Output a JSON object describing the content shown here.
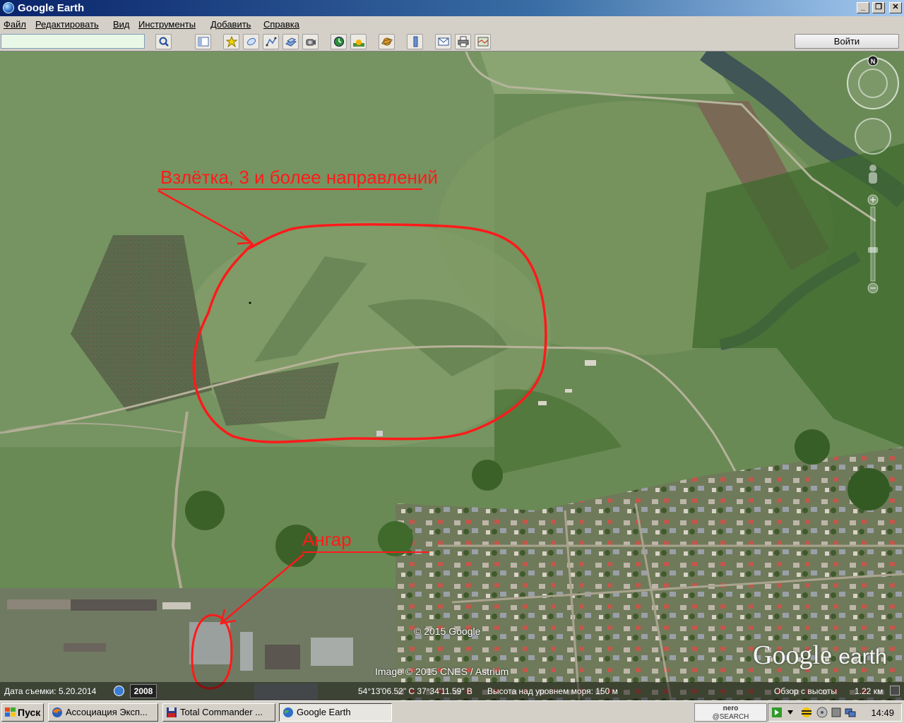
{
  "window": {
    "title": "Google Earth"
  },
  "menu": [
    "Файл",
    "Редактировать",
    "Вид",
    "Инструменты",
    "Добавить",
    "Справка"
  ],
  "toolbar": {
    "search_value": "",
    "signin_label": "Войти"
  },
  "annotations": {
    "runway_label": "Взлётка, 3 и более направлений",
    "hangar_label": "Ангар"
  },
  "map": {
    "copyright_top": "© 2015 Google",
    "copyright_image": "Image © 2015 CNES / Astrium",
    "logo_text": "Google",
    "logo_suffix": "earth"
  },
  "status": {
    "date_label": "Дата съемки: 5.20.2014",
    "year": "2008",
    "coords": "54°13'06.52\" С  37°34'11.59\" В",
    "elevation": "Высота над уровнем моря:   150 м",
    "eye_alt_label": "Обзор с высоты",
    "eye_alt_value": "1.22 км"
  },
  "taskbar": {
    "start_label": "Пуск",
    "tasks": [
      {
        "label": "Ассоциация Эксп...",
        "icon": "firefox-icon"
      },
      {
        "label": "Total Commander ...",
        "icon": "floppy-icon"
      },
      {
        "label": "Google Earth",
        "icon": "google-earth-icon"
      }
    ],
    "nero_top": "nero",
    "nero_bottom": "@SEARCH",
    "time": "14:49"
  },
  "colors": {
    "annotation": "#ff1a1a",
    "title_bar": "#0a246a"
  }
}
